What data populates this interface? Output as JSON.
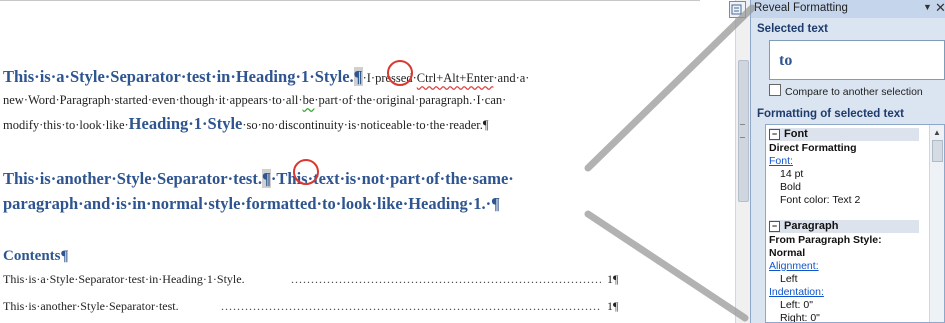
{
  "document": {
    "para1": {
      "heading": "This·is·a·Style·Separator·test·in·Heading·1·Style.",
      "pilcrow": "¶",
      "rest_a": "·I·",
      "pressed": "pressed",
      "space": "·",
      "ctrl": "Ctrl+Alt+Enter",
      "rest_b": "·and·a·",
      "line2_a": "new·Word·Paragraph·started·even·though·it·appears·to·all·",
      "be": "be",
      "line2_b": "·part·of·the·original·paragraph.·I·can·",
      "line3_a": "modify·this·to·look·like·",
      "line3_h": "Heading·1·Style",
      "line3_b": "·so·no·discontinuity·is·noticeable·to·the·reader.¶"
    },
    "para2": {
      "line1_a": "This·is·another·Style·Separator·test.",
      "pilcrow": "¶",
      "line1_b": "·This·text·is·not·part·of·the·same·",
      "line2": "paragraph·and·is·in·normal·style·formatted·to·look·like·Heading·1.·¶"
    },
    "contents": "Contents¶",
    "toc": [
      {
        "text": "This·is·a·Style·Separator·test·in·Heading·1·Style.",
        "page": "1¶"
      },
      {
        "text": "This·is·another·Style·Separator·test.",
        "page": "1¶"
      }
    ]
  },
  "pane": {
    "title": "Reveal Formatting",
    "dropdown": "▼",
    "close": "✕",
    "selected_text_label": "Selected text",
    "selected_text": "to",
    "compare_label": "Compare to another selection",
    "formatting_label": "Formatting of selected text",
    "font_group": "Font",
    "direct": "Direct Formatting",
    "font_link": "Font:",
    "font_size": "14 pt",
    "font_bold": "Bold",
    "font_color": "Font color: Text 2",
    "para_group": "Paragraph",
    "from_style": "From Paragraph Style:",
    "style_name": "Normal",
    "alignment_link": "Alignment:",
    "alignment_value": "Left",
    "indentation_link": "Indentation:",
    "left_indent": "Left:  0\"",
    "right_indent": "Right:  0\""
  },
  "icons": {
    "dropdown": "chevron-down-icon",
    "close": "close-icon",
    "pane_corner": "pane-icon",
    "collapse": "collapse-icon"
  },
  "colors": {
    "heading": "#2e5590",
    "circle": "#d9382f",
    "pane_bg": "#dbe5f1"
  }
}
